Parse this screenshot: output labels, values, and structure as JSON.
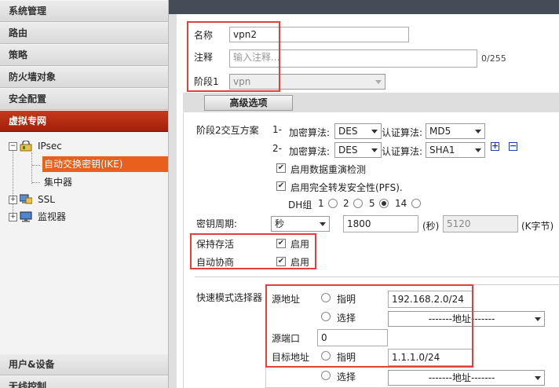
{
  "sidebar": {
    "menu_top": [
      "系统管理",
      "路由",
      "策略",
      "防火墙对象",
      "安全配置"
    ],
    "active_menu": "虚拟专网",
    "tree": {
      "ipsec": "IPsec",
      "ike": "自动交换密钥(IKE)",
      "concentrator": "集中器",
      "ssl": "SSL",
      "monitor": "监视器"
    },
    "menu_bottom": [
      "用户&设备",
      "无线控制"
    ]
  },
  "form": {
    "name_label": "名称",
    "name_value": "vpn2",
    "comment_label": "注释",
    "comment_placeholder": "输入注释...",
    "comment_counter": "0/255",
    "phase1_label": "阶段1",
    "phase1_value": "vpn",
    "advanced_button": "高级选项",
    "p2_label": "阶段2交互方案",
    "proposals": [
      {
        "num": "1-",
        "enc_label": "加密算法:",
        "enc": "DES",
        "auth_label": "认证算法:",
        "auth": "MD5"
      },
      {
        "num": "2-",
        "enc_label": "加密算法:",
        "enc": "DES",
        "auth_label": "认证算法:",
        "auth": "SHA1"
      }
    ],
    "replay_label": "启用数据重演检测",
    "replay_checked": true,
    "pfs_label": "启用完全转发安全性(PFS).",
    "pfs_checked": true,
    "dh_label": "DH组",
    "dh_options": [
      "1",
      "2",
      "5",
      "14"
    ],
    "dh_selected": "5",
    "keylife_label": "密钥周期:",
    "keylife_unit": "秒",
    "keylife_seconds": "1800",
    "seconds_label": "(秒)",
    "keylife_kbytes": "5120",
    "kbytes_label": "(K字节)",
    "keepalive_label": "保持存活",
    "keepalive_enable": "启用",
    "keepalive_checked": true,
    "autonego_label": "自动协商",
    "autonego_enable": "启用",
    "autonego_checked": true,
    "quickmode_label": "快速模式选择器",
    "src_addr_label": "源地址",
    "specify_label": "指明",
    "select_label": "选择",
    "src_addr_value": "192.168.2.0/24",
    "addr_select_placeholder": "-------地址-------",
    "src_port_label": "源端口",
    "src_port_value": "0",
    "dst_addr_label": "目标地址",
    "dst_addr_value": "1.1.1.0/24"
  },
  "colors": {
    "accent_red": "#e0413a",
    "menu_active": "#b42a10",
    "tree_selected": "#e8601c",
    "topbar": "#444c58"
  }
}
